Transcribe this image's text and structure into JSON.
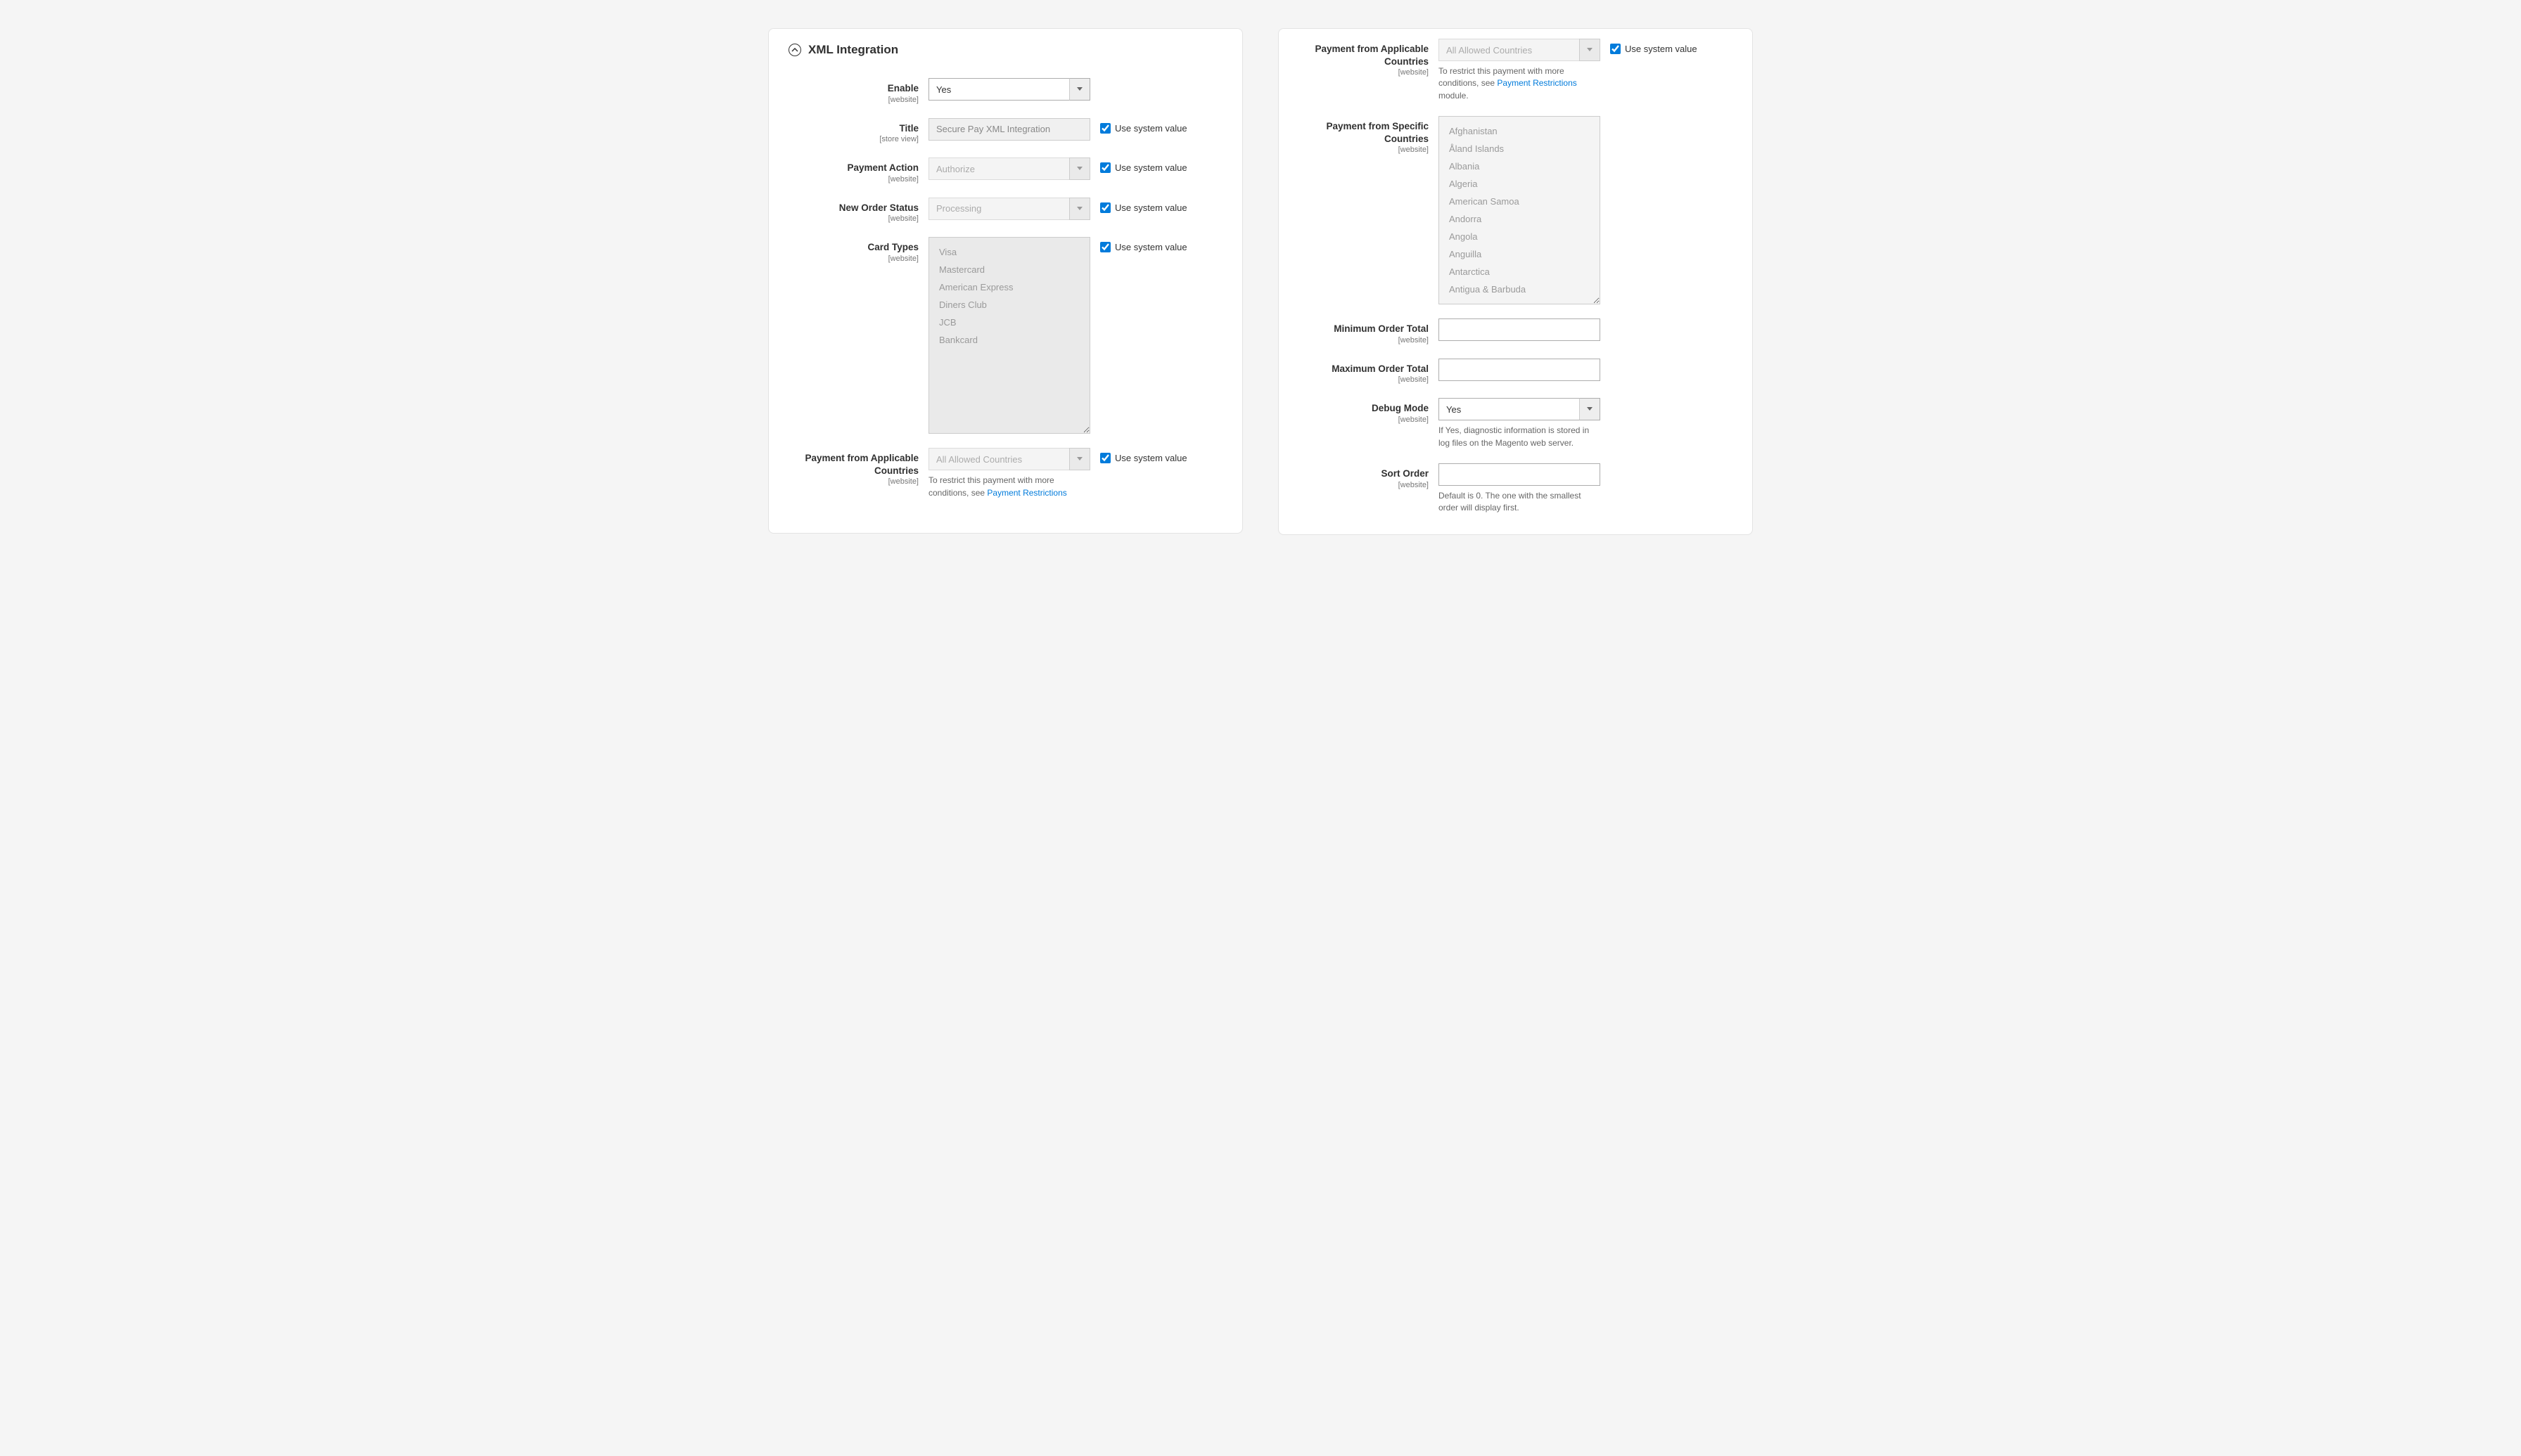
{
  "section_title": "XML Integration",
  "use_system_label": "Use system value",
  "fields": {
    "enable": {
      "label": "Enable",
      "scope": "[website]",
      "value": "Yes"
    },
    "title": {
      "label": "Title",
      "scope": "[store view]",
      "value": "Secure Pay XML Integration"
    },
    "payment_action": {
      "label": "Payment Action",
      "scope": "[website]",
      "value": "Authorize"
    },
    "new_order_status": {
      "label": "New Order Status",
      "scope": "[website]",
      "value": "Processing"
    },
    "card_types": {
      "label": "Card Types",
      "scope": "[website]",
      "options": [
        "Visa",
        "Mastercard",
        "American Express",
        "Diners Club",
        "JCB",
        "Bankcard"
      ]
    },
    "applicable_countries": {
      "label": "Payment from Applicable Countries",
      "scope": "[website]",
      "value": "All Allowed Countries",
      "help_prefix": "To restrict this payment with more conditions, see ",
      "help_link": "Payment Restrictions",
      "help_suffix": " module."
    },
    "specific_countries": {
      "label": "Payment from Specific Countries",
      "scope": "[website]",
      "options": [
        "Afghanistan",
        "Åland Islands",
        "Albania",
        "Algeria",
        "American Samoa",
        "Andorra",
        "Angola",
        "Anguilla",
        "Antarctica",
        "Antigua & Barbuda"
      ]
    },
    "min_order": {
      "label": "Minimum Order Total",
      "scope": "[website]",
      "value": ""
    },
    "max_order": {
      "label": "Maximum Order Total",
      "scope": "[website]",
      "value": ""
    },
    "debug_mode": {
      "label": "Debug Mode",
      "scope": "[website]",
      "value": "Yes",
      "help": "If Yes, diagnostic information is stored in log files on the Magento web server."
    },
    "sort_order": {
      "label": "Sort Order",
      "scope": "[website]",
      "value": "",
      "help": "Default is 0. The one with the smallest order will display first."
    }
  }
}
